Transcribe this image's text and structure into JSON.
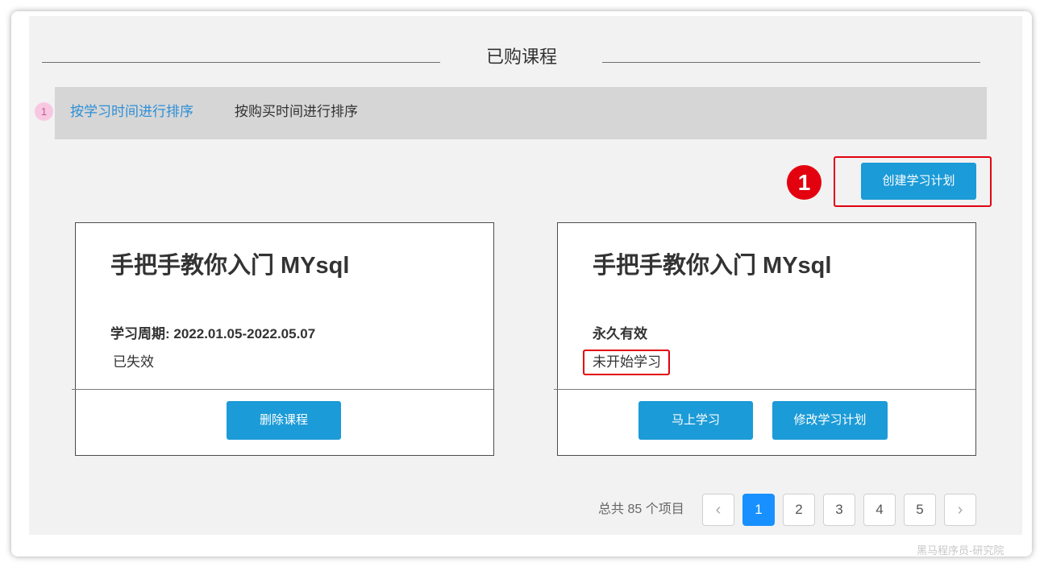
{
  "page": {
    "title": "已购课程"
  },
  "sort": {
    "badge": "1",
    "options": [
      {
        "label": "按学习时间进行排序",
        "active": true
      },
      {
        "label": "按购买时间进行排序",
        "active": false
      }
    ]
  },
  "annotation": {
    "step_number": "1"
  },
  "actions": {
    "create_plan_label": "创建学习计划"
  },
  "courses": [
    {
      "title": "手把手教你入门 MYsql",
      "period": "学习周期: 2022.01.05-2022.05.07",
      "status": "已失效",
      "buttons": [
        "删除课程"
      ]
    },
    {
      "title": "手把手教你入门 MYsql",
      "period": "永久有效",
      "status": "未开始学习",
      "buttons": [
        "马上学习",
        "修改学习计划"
      ]
    }
  ],
  "pagination": {
    "total_text": "总共 85 个项目",
    "prev_icon": "‹",
    "next_icon": "›",
    "pages": [
      "1",
      "2",
      "3",
      "4",
      "5"
    ],
    "current": "1"
  },
  "watermark": "黑马程序员-研究院",
  "colors": {
    "primary": "#1b9bd7",
    "active_page": "#1890ff",
    "annotation_red": "#e3000f",
    "active_sort": "#2d8fd6"
  }
}
